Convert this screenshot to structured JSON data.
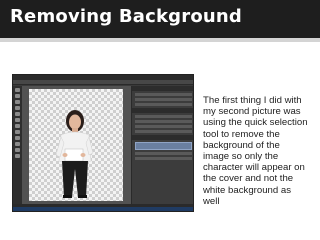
{
  "slide": {
    "title": "Removing Background",
    "body_lines": [
      "The first thing I did with",
      "my second picture was",
      "using the quick selection",
      "tool to remove the",
      "background of the",
      "image so only the",
      "character will appear on",
      "the cover and not the",
      "white background as",
      "well"
    ]
  },
  "colors": {
    "title_bar": "#1e1e1e",
    "title_text": "#ffffff",
    "body_text": "#222222"
  },
  "icons": {
    "photoshop_tools": "toolbox-icons",
    "taskbar": "windows-taskbar-icons"
  }
}
